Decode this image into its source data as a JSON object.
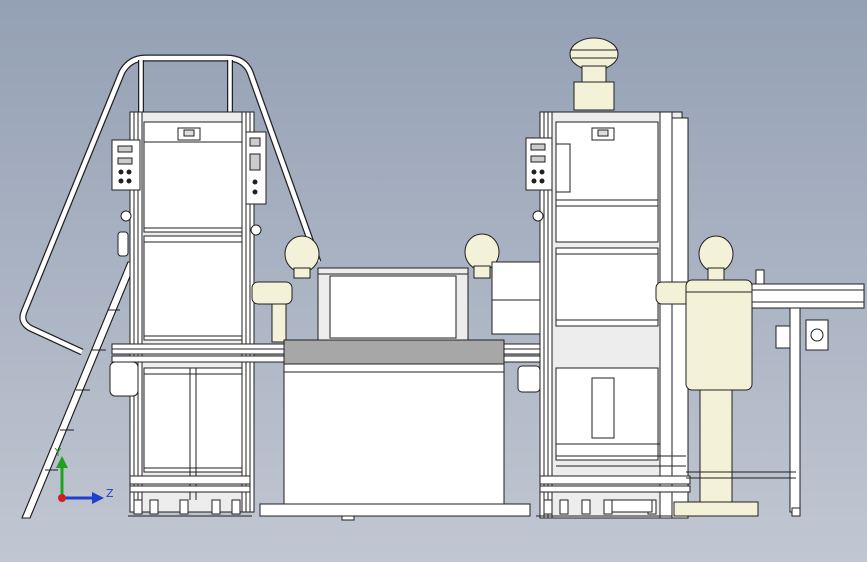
{
  "viewport": {
    "background_top": "#94a0b4",
    "background_bottom": "#c1c7d2"
  },
  "triad": {
    "y_label": "Y",
    "z_label": "Z",
    "y_color": "#1fa31f",
    "z_color": "#1f3fd0",
    "x_color": "#d01f1f"
  },
  "colors": {
    "line": "#202020",
    "panel": "#ffffff",
    "frame": "#ededed",
    "ivory": "#f3f2d8",
    "gray_band": "#a7a7a7"
  }
}
